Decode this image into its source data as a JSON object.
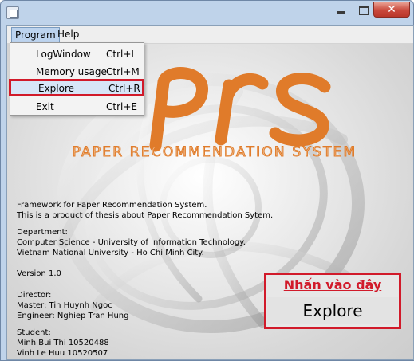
{
  "window": {
    "title": ""
  },
  "title_buttons": {
    "close_glyph": "✕"
  },
  "menubar": {
    "program": "Program",
    "help": "Help"
  },
  "program_menu": [
    {
      "label": "LogWindow",
      "accel": "Ctrl+L"
    },
    {
      "label": "Memory usage",
      "accel": "Ctrl+M"
    },
    {
      "label": "Explore",
      "accel": "Ctrl+R"
    },
    {
      "label": "Exit",
      "accel": "Ctrl+E"
    }
  ],
  "logo": {
    "subtitle": "PAPER RECOMMENDATION SYSTEM",
    "accent_color": "#e07b2a"
  },
  "info": {
    "line1": "Framework for Paper Recommendation System.",
    "line2": "This is a product of thesis about Paper Recommendation Sytem.",
    "dept_label": "Department:",
    "dept1": "Computer Science - University of Information Technology.",
    "dept2": "Vietnam National University - Ho Chi Minh City.",
    "version": "Version 1.0",
    "director_label": "Director:",
    "master": "Master: Tin Huynh Ngoc",
    "engineer": "Engineer: Nghiep Tran Hung",
    "student_label": "Student:",
    "student1": "Minh Bui Thi 10520488",
    "student2": "Vinh Le Huu 10520507"
  },
  "explore_panel": {
    "hint": "Nhấn vào đây",
    "button": "Explore",
    "highlight_color": "#d11a2a"
  }
}
